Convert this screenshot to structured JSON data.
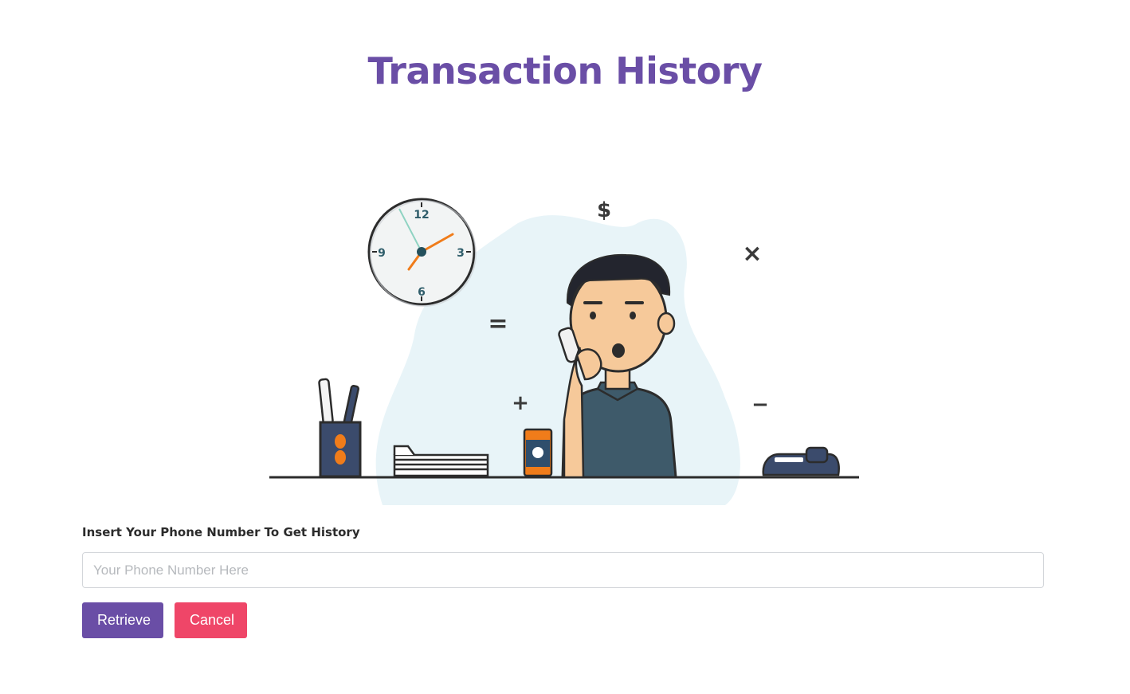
{
  "header": {
    "title": "Transaction History"
  },
  "illustration": {
    "clock_numbers": [
      "12",
      "3",
      "6",
      "9"
    ],
    "symbols": {
      "dollar": "$",
      "times": "×",
      "equals": "=",
      "plus": "+",
      "minus": "−"
    }
  },
  "form": {
    "label": "Insert Your Phone Number To Get History",
    "phone_placeholder": "Your Phone Number Here",
    "phone_value": "",
    "retrieve_label": "Retrieve",
    "cancel_label": "Cancel"
  },
  "colors": {
    "accent": "#6a4ea6",
    "danger": "#ef4668",
    "blob": "#e8f4f8"
  }
}
